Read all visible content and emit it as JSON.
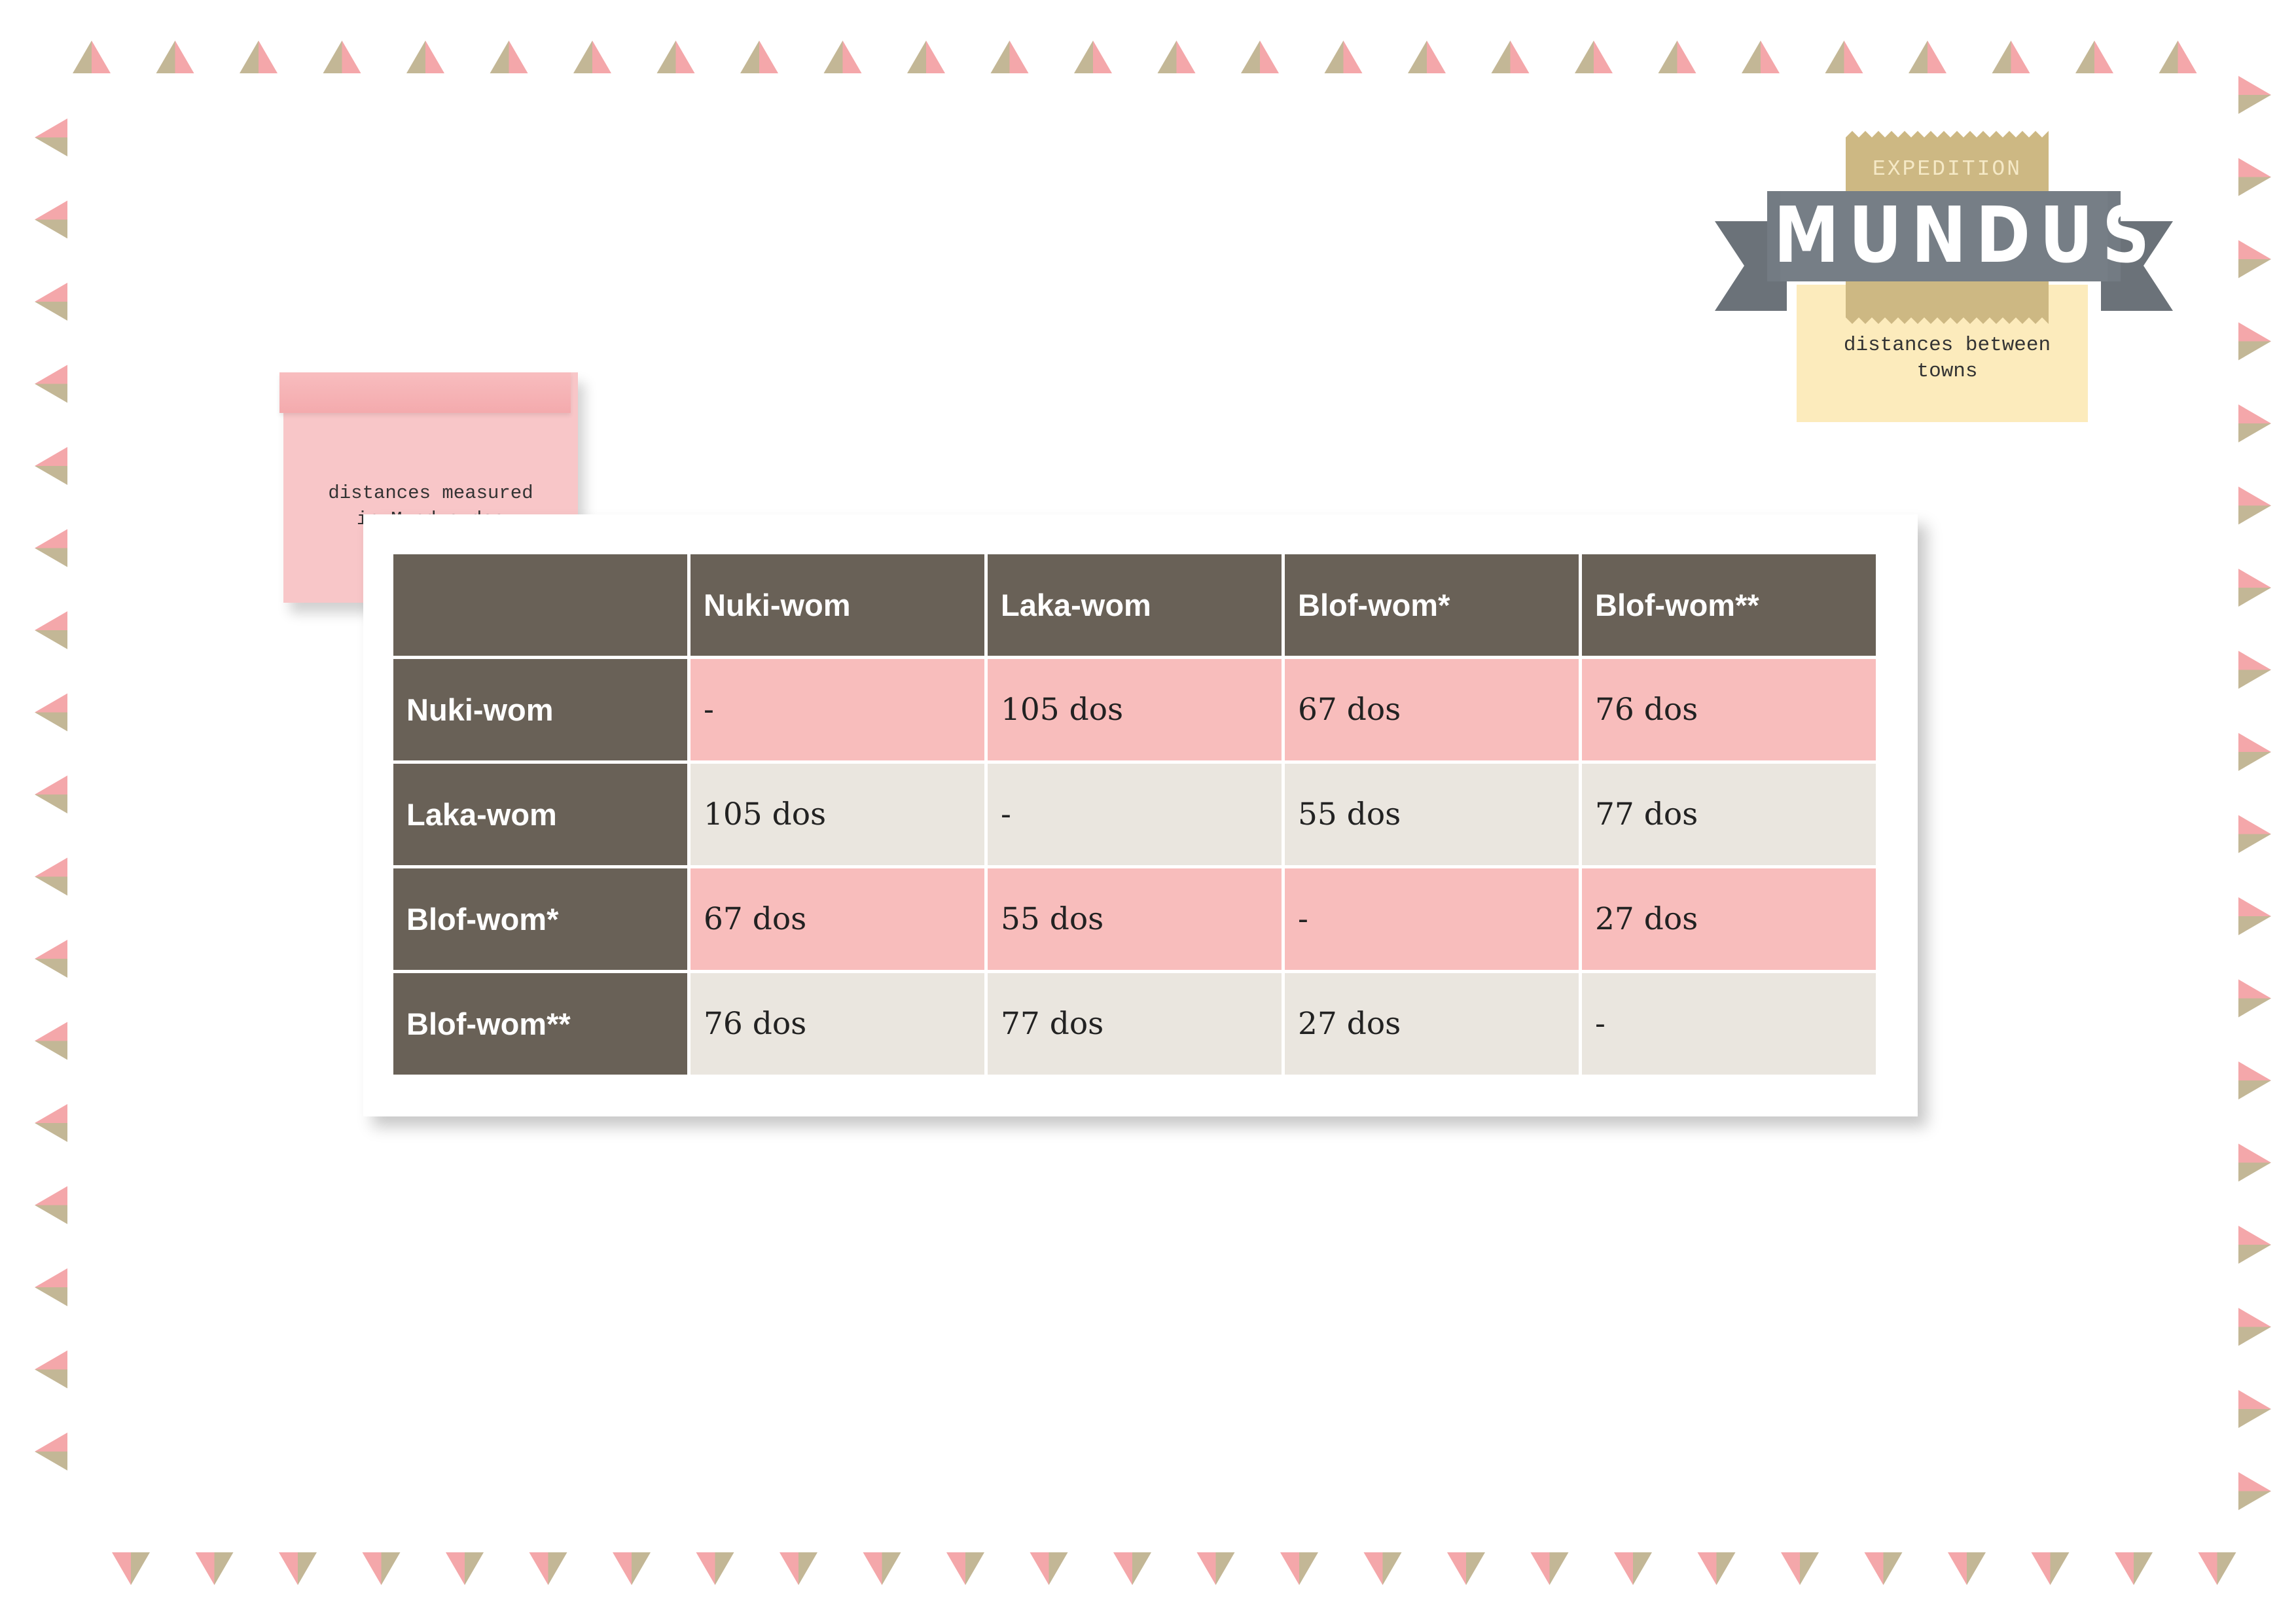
{
  "colors": {
    "header_bg": "#696157",
    "row_pink": "#f8bdbc",
    "row_beige": "#eae6df",
    "sticky": "#f8c6c8",
    "ribbon": "#707880",
    "gold": "#cdb883",
    "label_yellow": "#fcebbc",
    "triangle_pink": "#f4a7aa",
    "triangle_tan": "#c3b796"
  },
  "badge": {
    "top_text": "EXPEDITION",
    "title": "MUNDUS",
    "subtitle": "distances between\ntowns"
  },
  "sticky_note": {
    "text": "distances measured\nin Mundus-dos"
  },
  "table": {
    "columns": [
      "",
      "Nuki-wom",
      "Laka-wom",
      "Blof-wom*",
      "Blof-wom**"
    ],
    "rows": [
      {
        "label": "Nuki-wom",
        "cells": [
          "-",
          "105 dos",
          "67 dos",
          "76 dos"
        ]
      },
      {
        "label": "Laka-wom",
        "cells": [
          "105 dos",
          "-",
          "55 dos",
          "77 dos"
        ]
      },
      {
        "label": "Blof-wom*",
        "cells": [
          "67 dos",
          "55 dos",
          "-",
          "27 dos"
        ]
      },
      {
        "label": "Blof-wom**",
        "cells": [
          "76 dos",
          "77 dos",
          "27 dos",
          "-"
        ]
      }
    ]
  }
}
